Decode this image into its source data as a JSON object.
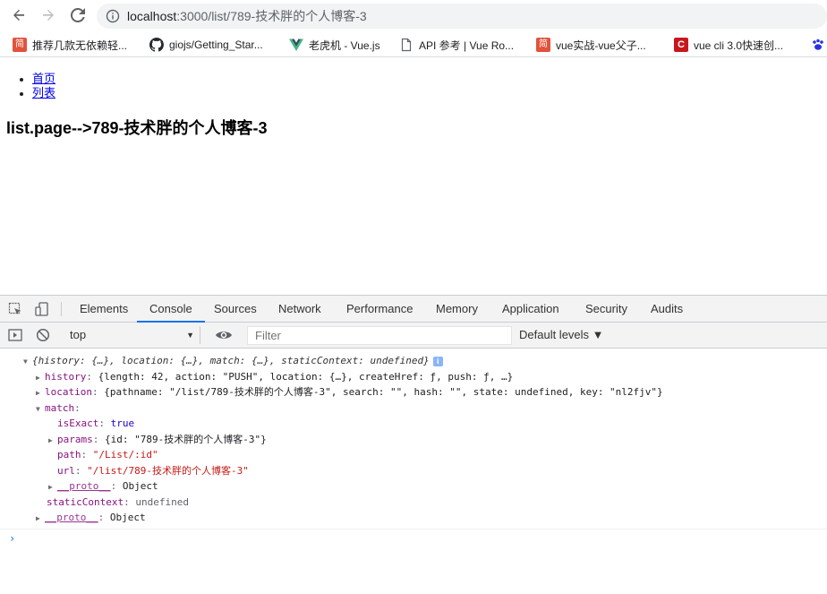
{
  "browser": {
    "url_host": "localhost",
    "url_path": ":3000/list/789-技术胖的个人博客-3",
    "bookmarks": [
      {
        "label": "推荐几款无依赖轻...",
        "icon": "jianshu-icon",
        "glyph": "简"
      },
      {
        "label": "giojs/Getting_Star...",
        "icon": "github-icon",
        "glyph": ""
      },
      {
        "label": "老虎机 - Vue.js",
        "icon": "vue-icon",
        "glyph": ""
      },
      {
        "label": "API 参考 | Vue Ro...",
        "icon": "document-icon",
        "glyph": ""
      },
      {
        "label": "vue实战-vue父子...",
        "icon": "jianshu-icon",
        "glyph": "简"
      },
      {
        "label": "vue cli 3.0快速创...",
        "icon": "csdn-icon",
        "glyph": "C"
      }
    ]
  },
  "page": {
    "nav": [
      {
        "label": "首页"
      },
      {
        "label": "列表"
      }
    ],
    "heading": "list.page-->789-技术胖的个人博客-3"
  },
  "devtools": {
    "tabs": [
      "Elements",
      "Console",
      "Sources",
      "Network",
      "Performance",
      "Memory",
      "Application",
      "Security",
      "Audits"
    ],
    "active_tab": "Console",
    "context": "top",
    "filter_placeholder": "Filter",
    "levels": "Default levels ▼",
    "console": {
      "root_summary": "{history: {…}, location: {…}, match: {…}, staticContext: undefined}",
      "history_key": "history",
      "history_value": "{length: 42, action: \"PUSH\", location: {…}, createHref: ƒ, push: ƒ, …}",
      "location_key": "location",
      "location_value": "{pathname: \"/list/789-技术胖的个人博客-3\", search: \"\", hash: \"\", state: undefined, key: \"nl2fjv\"}",
      "match_key": "match",
      "isExact_key": "isExact",
      "isExact_value": "true",
      "params_key": "params",
      "params_value": "{id: \"789-技术胖的个人博客-3\"}",
      "path_key": "path",
      "path_value": "\"/List/:id\"",
      "url_key": "url",
      "url_value": "\"/list/789-技术胖的个人博客-3\"",
      "proto_key": "__proto__",
      "proto_value": "Object",
      "staticContext_key": "staticContext",
      "staticContext_value": "undefined"
    }
  }
}
